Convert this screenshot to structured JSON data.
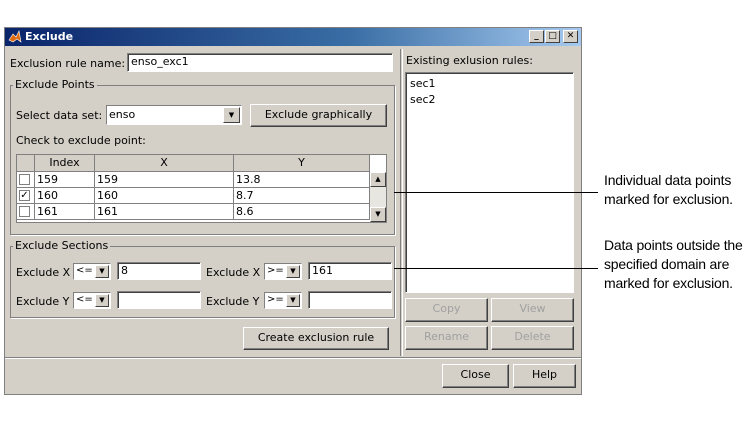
{
  "window": {
    "title": "Exclude",
    "minimize_glyph": "_",
    "maximize_glyph": "□",
    "close_glyph": "✕"
  },
  "rule_name": {
    "label": "Exclusion rule name:",
    "value": "enso_exc1"
  },
  "exclude_points": {
    "group_title": "Exclude Points",
    "dataset_label": "Select data set:",
    "dataset_value": "enso",
    "exclude_graphically_label": "Exclude graphically",
    "check_label": "Check to exclude point:",
    "table": {
      "headers": [
        "Index",
        "X",
        "Y"
      ],
      "rows": [
        {
          "checked": false,
          "index": "159",
          "x": "159",
          "y": "13.8"
        },
        {
          "checked": true,
          "index": "160",
          "x": "160",
          "y": "8.7"
        },
        {
          "checked": false,
          "index": "161",
          "x": "161",
          "y": "8.6"
        }
      ]
    }
  },
  "exclude_sections": {
    "group_title": "Exclude Sections",
    "x_left_label": "Exclude X",
    "x_left_op": "<=",
    "x_left_value": "8",
    "x_right_label": "Exclude X",
    "x_right_op": ">=",
    "x_right_value": "161",
    "y_left_label": "Exclude Y",
    "y_left_op": "<=",
    "y_left_value": "",
    "y_right_label": "Exclude Y",
    "y_right_op": ">=",
    "y_right_value": ""
  },
  "create_button": "Create exclusion rule",
  "existing": {
    "label": "Existing exlusion rules:",
    "items": [
      "sec1",
      "sec2"
    ],
    "copy": "Copy",
    "view": "View",
    "rename": "Rename",
    "delete": "Delete"
  },
  "footer": {
    "close": "Close",
    "help": "Help"
  },
  "annotations": {
    "points_line1": "Individual data points",
    "points_line2": "marked for exclusion.",
    "sections_line1": "Data points outside the",
    "sections_line2": "specified domain are",
    "sections_line3": "marked for exclusion."
  },
  "colors": {
    "dialog_bg": "#d4d0c8",
    "titlebar_start": "#0a246a",
    "titlebar_end": "#a6caf0"
  }
}
